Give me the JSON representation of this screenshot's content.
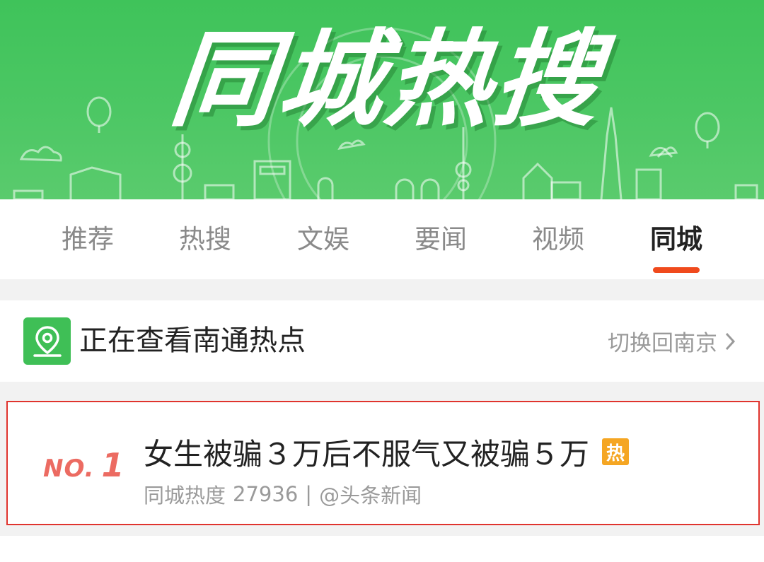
{
  "banner": {
    "title": "同城热搜",
    "bg_color": "#4cc764"
  },
  "tabs": [
    {
      "label": "推荐",
      "active": false
    },
    {
      "label": "热搜",
      "active": false
    },
    {
      "label": "文娱",
      "active": false
    },
    {
      "label": "要闻",
      "active": false
    },
    {
      "label": "视频",
      "active": false
    },
    {
      "label": "同城",
      "active": true
    }
  ],
  "location": {
    "icon": "location-pin-icon",
    "text": "正在查看南通热点",
    "switch_label": "切换回南京",
    "switch_icon": "chevron-right-icon"
  },
  "news": [
    {
      "rank_prefix": "NO.",
      "rank": "1",
      "title": "女生被骗３万后不服气又被骗５万",
      "badge": "热",
      "heat_label": "同城热度",
      "heat_value": "27936",
      "separator": "|",
      "source": "@头条新闻"
    }
  ],
  "colors": {
    "accent": "#f04a1d",
    "highlight_border": "#e0342e",
    "location_icon_bg": "#3fbf56",
    "hot_badge": "#f5a623",
    "rank": "#ec6b62"
  }
}
